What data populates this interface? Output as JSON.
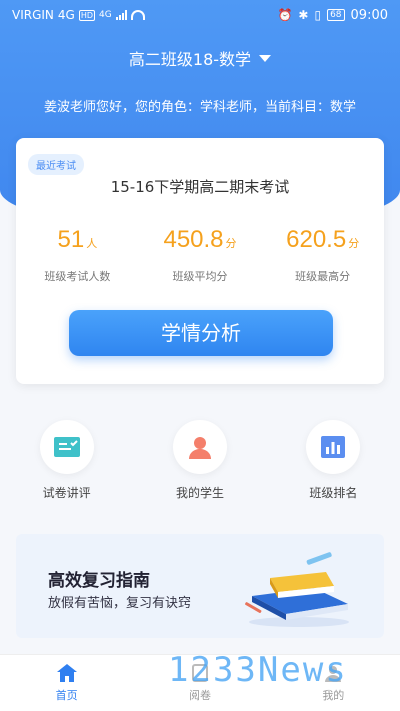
{
  "statusbar": {
    "carrier": "VIRGIN",
    "network": "4G",
    "hd": "HD",
    "network2": "4G",
    "battery": "68",
    "time": "09:00"
  },
  "header": {
    "class_name": "高二班级18-数学",
    "greeting": "姜波老师您好，您的角色：学科老师，当前科目：数学"
  },
  "exam_card": {
    "badge": "最近考试",
    "exam_name": "15-16下学期高二期末考试",
    "stats": [
      {
        "value": "51",
        "unit": "人",
        "label": "班级考试人数"
      },
      {
        "value": "450.8",
        "unit": "分",
        "label": "班级平均分"
      },
      {
        "value": "620.5",
        "unit": "分",
        "label": "班级最高分"
      }
    ],
    "analyze_label": "学情分析"
  },
  "features": [
    {
      "label": "试卷讲评",
      "icon": "exam-review-icon"
    },
    {
      "label": "我的学生",
      "icon": "student-icon"
    },
    {
      "label": "班级排名",
      "icon": "ranking-icon"
    }
  ],
  "banner": {
    "title": "高效复习指南",
    "subtitle": "放假有苦恼，复习有诀窍"
  },
  "tabs": [
    {
      "label": "首页",
      "icon": "home-icon"
    },
    {
      "label": "阅卷",
      "icon": "grade-icon"
    },
    {
      "label": "我的",
      "icon": "profile-icon"
    }
  ],
  "watermark": "1233News",
  "colors": {
    "brand_blue": "#3f86ee",
    "accent_orange": "#f5a11d",
    "tab_active": "#2f7ff0"
  }
}
